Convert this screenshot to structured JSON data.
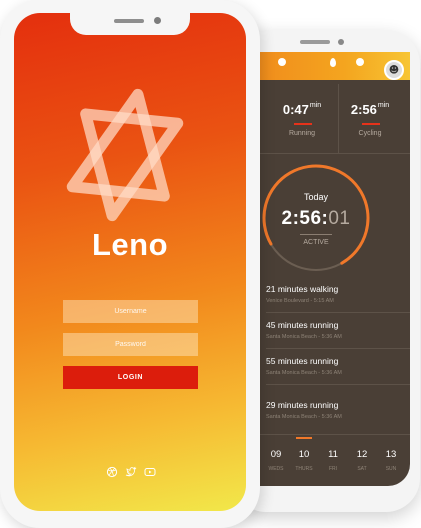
{
  "login_screen": {
    "brand_name": "Leno",
    "username_placeholder": "Username",
    "password_placeholder": "Password",
    "login_label": "LOGIN",
    "social_icons": [
      "dribbble-icon",
      "twitter-icon",
      "youtube-icon"
    ]
  },
  "tracker_screen": {
    "stats": [
      {
        "value": "0:47",
        "unit": "min",
        "label": "Running"
      },
      {
        "value": "2:56",
        "unit": "min",
        "label": "Cycling"
      }
    ],
    "ring": {
      "day_label": "Today",
      "time_main": "2:56:",
      "time_dim": "01",
      "status": "ACTIVE",
      "progress": 0.75
    },
    "activities": [
      {
        "title": "21 minutes walking",
        "subtitle": "Venice Boulevard - 5:15 AM"
      },
      {
        "title": "45 minutes running",
        "subtitle": "Santa Monica Beach - 5:36 AM"
      },
      {
        "title": "55 minutes running",
        "subtitle": "Santa Monica Beach - 5:36 AM"
      },
      {
        "title": "29 minutes running",
        "subtitle": "Santa Monica Beach - 5:36 AM"
      }
    ],
    "days": [
      {
        "num": "09",
        "name": "WEDS"
      },
      {
        "num": "10",
        "name": "THURS",
        "selected": true
      },
      {
        "num": "11",
        "name": "FRI"
      },
      {
        "num": "12",
        "name": "SAT"
      },
      {
        "num": "13",
        "name": "SUN"
      }
    ]
  },
  "colors": {
    "accent_red": "#dc1d0c",
    "gradient_top": "#e42f0e",
    "gradient_bottom": "#f2e84a",
    "tracker_bg": "#4a3f36",
    "ring_orange": "#f0782a"
  }
}
